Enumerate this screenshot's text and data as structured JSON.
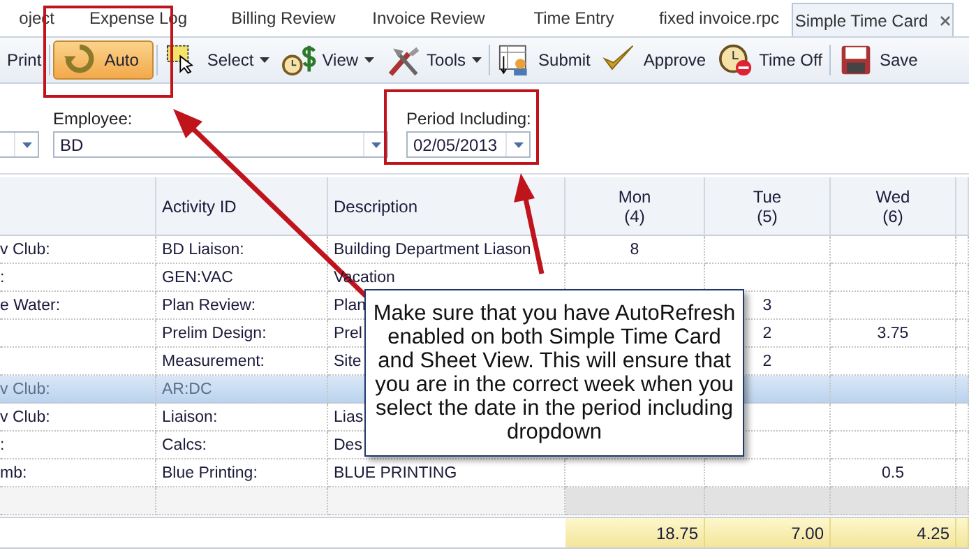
{
  "tabs": [
    {
      "label": "oject",
      "selected": false
    },
    {
      "label": "Expense Log",
      "selected": false
    },
    {
      "label": "Billing Review",
      "selected": false
    },
    {
      "label": "Invoice Review",
      "selected": false
    },
    {
      "label": "Time Entry",
      "selected": false
    },
    {
      "label": "fixed invoice.rpc",
      "selected": false
    },
    {
      "label": "Simple Time Card",
      "selected": true
    }
  ],
  "toolbar": [
    {
      "kind": "button",
      "label": "Print",
      "on": false
    },
    {
      "kind": "button",
      "label": "Auto",
      "on": true
    },
    {
      "kind": "dropdown",
      "label": "Select",
      "on": false
    },
    {
      "kind": "dropdown",
      "label": "View",
      "on": false
    },
    {
      "kind": "dropdown",
      "label": "Tools",
      "on": false
    },
    {
      "kind": "button",
      "label": "Submit",
      "on": false
    },
    {
      "kind": "button",
      "label": "Approve",
      "on": false
    },
    {
      "kind": "button",
      "label": "Time Off",
      "on": false
    },
    {
      "kind": "button",
      "label": "Save",
      "on": false
    }
  ],
  "filters": {
    "employee": {
      "label": "Employee:",
      "value": "BD"
    },
    "period": {
      "label": "Period Including:",
      "value": "02/05/2013"
    }
  },
  "grid": {
    "columns": [
      {
        "label": "Activity ID"
      },
      {
        "label": "Description"
      },
      {
        "label": "Mon",
        "sub": "(4)"
      },
      {
        "label": "Tue",
        "sub": "(5)"
      },
      {
        "label": "Wed",
        "sub": "(6)"
      }
    ],
    "rows": [
      {
        "project": "v Club:",
        "activity": "BD Liaison:",
        "description": "Building Department Liason",
        "mon": "8",
        "selected": false
      },
      {
        "project": ":",
        "activity": "GEN:VAC",
        "description": "Vacation",
        "selected": false
      },
      {
        "project": "e Water:",
        "activity": "Plan Review:",
        "description": "Plan",
        "tue": "3",
        "selected": false
      },
      {
        "activity": "Prelim Design:",
        "description": "Prel",
        "tue": "2",
        "wed": "3.75",
        "selected": false
      },
      {
        "activity": "Measurement:",
        "description": "Site",
        "tue": "2",
        "selected": false
      },
      {
        "project": "v Club:",
        "activity": "AR:DC",
        "selected": true
      },
      {
        "project": "v Club:",
        "activity": "Liaison:",
        "description": "Lias",
        "selected": false
      },
      {
        "project": ":",
        "activity": "Calcs:",
        "description": "Des",
        "selected": false
      },
      {
        "project": "mb:",
        "activity": "Blue Printing:",
        "description": "BLUE PRINTING",
        "wed": "0.5",
        "selected": false
      }
    ],
    "totals": {
      "mon": "18.75",
      "tue": "7.00",
      "wed": "4.25"
    }
  },
  "callout": "Make sure that you have AutoRefresh enabled on both Simple Time Card and Sheet View. This will ensure that you are in the correct week when you select the date in the period including dropdown"
}
